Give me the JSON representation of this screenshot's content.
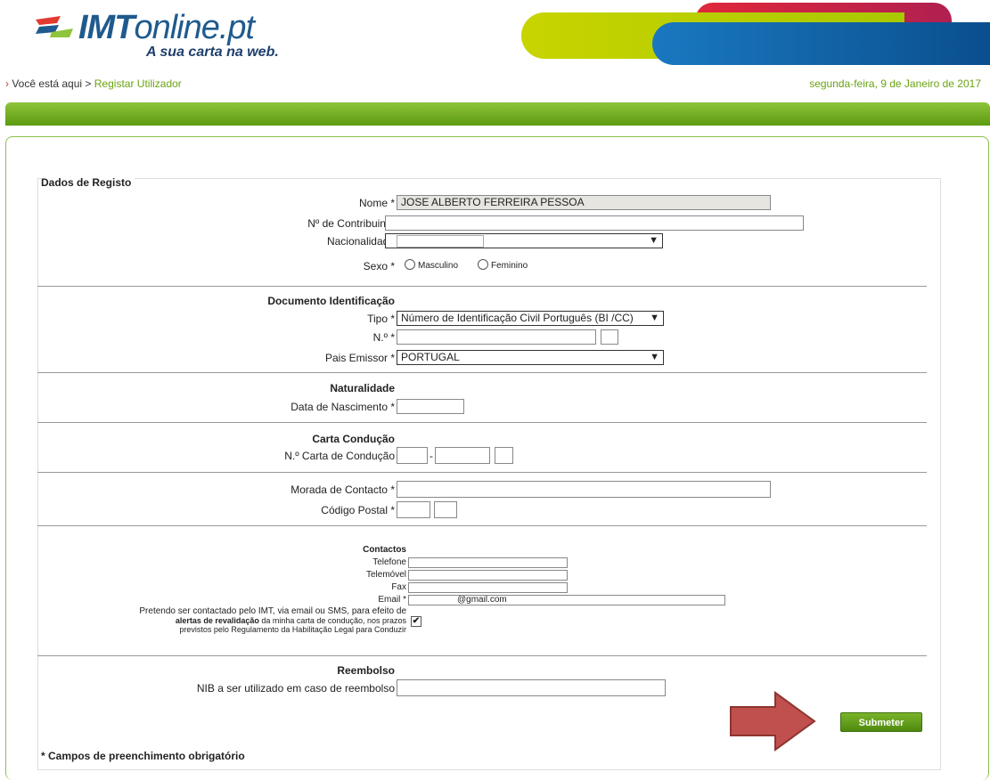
{
  "header": {
    "brand_imt": "IMT",
    "brand_online": "online.pt",
    "tagline": "A sua carta na web."
  },
  "breadcrumb": {
    "arrow": "›",
    "prefix": "Você está aqui >",
    "current": "Registar Utilizador"
  },
  "date": "segunda-feira, 9 de Janeiro de 2017",
  "form": {
    "legend": "Dados de Registo",
    "nome": {
      "label": "Nome *",
      "value": "JOSE ALBERTO FERREIRA PESSOA"
    },
    "contribuinte": {
      "label": "Nº de Contribuinte",
      "value": ""
    },
    "nacionalidade": {
      "label": "Nacionalidade",
      "value": ""
    },
    "sexo": {
      "label": "Sexo *",
      "masculino": "Masculino",
      "feminino": "Feminino"
    },
    "documento": {
      "title": "Documento Identificação",
      "tipo_label": "Tipo *",
      "tipo_value": "Número de Identificação Civil Português (BI /CC)",
      "numero_label": "N.º *",
      "pais_label": "Pais Emissor *",
      "pais_value": "PORTUGAL"
    },
    "naturalidade": {
      "title": "Naturalidade",
      "data_label": "Data de Nascimento *"
    },
    "carta": {
      "title": "Carta Condução",
      "numero_label": "N.º Carta de Condução",
      "separator": "-"
    },
    "morada": {
      "label": "Morada de Contacto *",
      "cp_label": "Código Postal *"
    },
    "contactos": {
      "title": "Contactos",
      "telefone": "Telefone",
      "telemovel": "Telemóvel",
      "fax": "Fax",
      "email": "Email *",
      "email_value": "@gmail.com",
      "consent_line1": "Pretendo ser contactado pelo IMT, via email ou SMS, para efeito de",
      "consent_line2_bold": "alertas de revalidação",
      "consent_line2_rest": " da minha carta de condução, nos prazos",
      "consent_line3": "previstos pelo Regulamento da Habilitação Legal para Conduzir",
      "consent_checked": "✔"
    },
    "reembolso": {
      "title": "Reembolso",
      "nib_label": "NIB a ser utilizado em caso de reembolso"
    },
    "submit_label": "Submeter",
    "footnote": "* Campos de preenchimento obrigatório"
  },
  "colors": {
    "brand_blue": "#1f5a8e",
    "accent_green": "#6aa312",
    "arrow_red": "#c0392b"
  }
}
